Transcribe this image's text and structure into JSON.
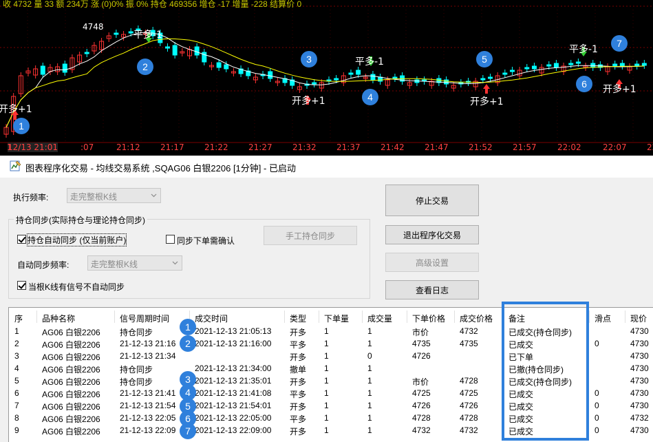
{
  "quote_bar": {
    "text": "收 4732 量 33 额 234万 涨 (0)0% 振 0% 持仓 469356 增仓 -17 增量 -228 结算价 0"
  },
  "chart": {
    "peak_label": "4748",
    "time_labels": [
      "12/13 21:01",
      ":07",
      "21:12",
      "21:17",
      "21:22",
      "21:27",
      "21:32",
      "21:37",
      "21:42",
      "21:47",
      "21:52",
      "21:57",
      "22:02",
      "22:07",
      "22:"
    ],
    "cursor_label": "1",
    "signals": [
      {
        "text": "开多+1"
      },
      {
        "text": "平多-1"
      },
      {
        "text": "开多+1"
      },
      {
        "text": "平多-1"
      },
      {
        "text": "开多+1"
      },
      {
        "text": "平多-1"
      },
      {
        "text": "开多+1"
      }
    ],
    "colors": {
      "up": "#ff3232",
      "down": "#00ffff",
      "ma_fast": "#ffffff",
      "ma_slow": "#ffff00",
      "badge": "#2f80dc",
      "highlight": "#2f80dc"
    }
  },
  "badges": [
    "1",
    "2",
    "3",
    "4",
    "5",
    "6",
    "7"
  ],
  "dialog": {
    "title": "图表程序化交易 - 均线交易系统 ,SQAG06 白银2206 [1分钟] - 已启动",
    "exec_freq_label": "执行频率:",
    "exec_freq_value": "走完整根K线",
    "sync_group_label": "持仓同步(实际持仓与理论持仓同步)",
    "auto_sync_label": "持仓自动同步 (仅当前账户)",
    "auto_sync_checked": true,
    "confirm_label": "同步下单需确认",
    "confirm_checked": false,
    "manual_sync_button": "手工持仓同步",
    "auto_sync_freq_label": "自动同步频率:",
    "auto_sync_freq_value": "走完整根K线",
    "no_auto_sync_label": "当根K线有信号不自动同步",
    "no_auto_sync_checked": true,
    "buttons": {
      "stop": "停止交易",
      "exit": "退出程序化交易",
      "advanced": "高级设置",
      "log": "查看日志"
    }
  },
  "table": {
    "headers": [
      "序",
      "品种名称",
      "信号周期时间",
      "成交时间",
      "类型",
      "下单量",
      "成交量",
      "下单价格",
      "成交价格",
      "备注",
      "滑点",
      "现价"
    ],
    "rows": [
      [
        "1",
        "AG06 白银2206",
        "持仓同步",
        "2021-12-13 21:05:13",
        "开多",
        "1",
        "1",
        "市价",
        "4732",
        "已成交(持仓同步)",
        "",
        "4730"
      ],
      [
        "2",
        "AG06 白银2206",
        "21-12-13 21:16",
        "2021-12-13 21:16:00",
        "平多",
        "1",
        "1",
        "4735",
        "4735",
        "已成交",
        "0",
        "4730"
      ],
      [
        "3",
        "AG06 白银2206",
        "21-12-13 21:34",
        "",
        "开多",
        "1",
        "0",
        "4726",
        "",
        "已下单",
        "",
        "4730"
      ],
      [
        "4",
        "AG06 白银2206",
        "持仓同步",
        "2021-12-13 21:34:00",
        "撤单",
        "1",
        "1",
        "",
        "",
        "已撤(持仓同步)",
        "",
        "4730"
      ],
      [
        "5",
        "AG06 白银2206",
        "持仓同步",
        "2021-12-13 21:35:01",
        "开多",
        "1",
        "1",
        "市价",
        "4728",
        "已成交(持仓同步)",
        "",
        "4730"
      ],
      [
        "6",
        "AG06 白银2206",
        "21-12-13 21:41",
        "2021-12-13 21:41:08",
        "平多",
        "1",
        "1",
        "4725",
        "4725",
        "已成交",
        "0",
        "4730"
      ],
      [
        "7",
        "AG06 白银2206",
        "21-12-13 21:54",
        "2021-12-13 21:54:01",
        "开多",
        "1",
        "1",
        "4726",
        "4726",
        "已成交",
        "0",
        "4730"
      ],
      [
        "8",
        "AG06 白银2206",
        "21-12-13 22:05",
        "2021-12-13 22:05:00",
        "平多",
        "1",
        "1",
        "4728",
        "4728",
        "已成交",
        "0",
        "4732"
      ],
      [
        "9",
        "AG06 白银2206",
        "21-12-13 22:09",
        "2021-12-13 22:09:00",
        "开多",
        "1",
        "1",
        "4732",
        "4732",
        "已成交",
        "0",
        "4730"
      ]
    ]
  }
}
